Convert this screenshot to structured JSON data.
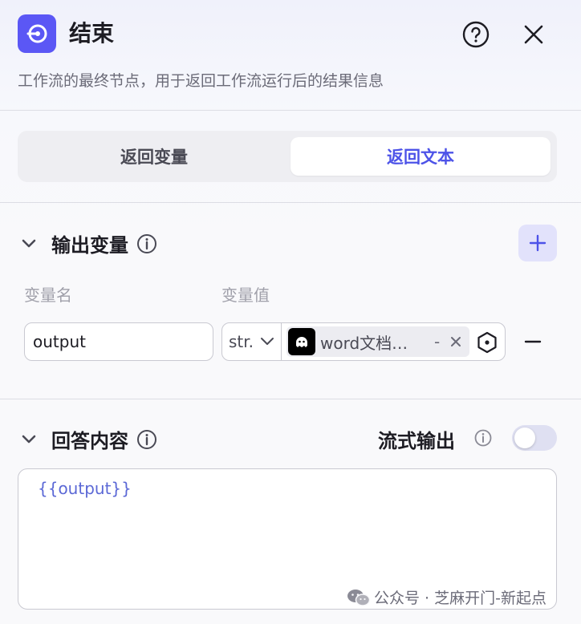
{
  "header": {
    "title": "结束",
    "description": "工作流的最终节点，用于返回工作流运行后的结果信息"
  },
  "return_mode": {
    "tabs": [
      "返回变量",
      "返回文本"
    ],
    "selected": "返回文本"
  },
  "output_vars": {
    "title": "输出变量",
    "col_name": "变量名",
    "col_value": "变量值",
    "rows": [
      {
        "name": "output",
        "type": "str.",
        "ref": "word文档…",
        "ref_suffix": "-"
      }
    ]
  },
  "answer": {
    "title": "回答内容",
    "stream_label": "流式输出",
    "stream_enabled": false,
    "content": "{{output}}"
  },
  "watermark": {
    "text": "公众号 · 芝麻开门-新起点"
  },
  "colors": {
    "accent": "#4d53e8",
    "node_icon_bg": "#5b57f5"
  },
  "icons": {
    "node": "end-node-icon",
    "help": "question-circle-icon",
    "close": "close-icon",
    "collapse": "chevron-down-icon",
    "info": "info-icon",
    "add": "plus-icon",
    "remove": "minus-icon",
    "variable_picker": "variable-picker-icon",
    "wechat": "wechat-icon"
  }
}
